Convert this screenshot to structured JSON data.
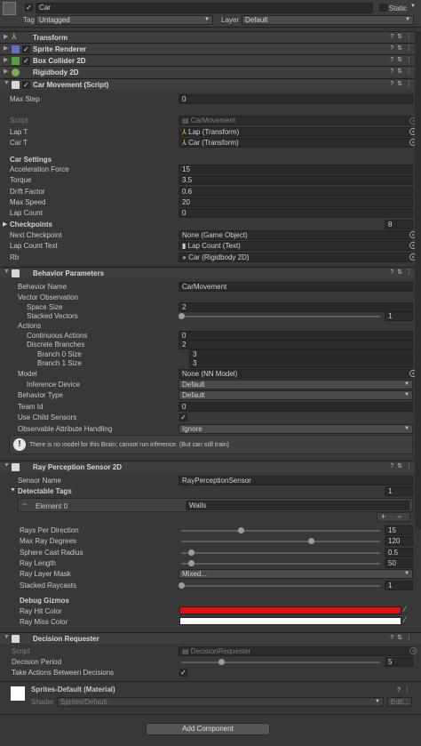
{
  "header": {
    "name": "Car",
    "static_label": "Static",
    "tag_label": "Tag",
    "tag_value": "Untagged",
    "layer_label": "Layer",
    "layer_value": "Default"
  },
  "components": {
    "transform": "Transform",
    "sprite_renderer": "Sprite Renderer",
    "box_collider": "Box Collider 2D",
    "rigidbody": "Rigidbody 2D",
    "car_movement": "Car Movement (Script)",
    "behavior_parameters": "Behavior Parameters",
    "ray_perception": "Ray Perception Sensor 2D",
    "decision_requester": "Decision Requester",
    "material": "Sprites-Default (Material)"
  },
  "car_movement": {
    "max_step_label": "Max Step",
    "max_step": "0",
    "script_label": "Script",
    "script": "CarMovement",
    "lap_t_label": "Lap T",
    "lap_t": "Lap (Transform)",
    "car_t_label": "Car T",
    "car_t": "Car (Transform)",
    "settings_header": "Car Settings",
    "accel_label": "Acceleration Force",
    "accel": "15",
    "torque_label": "Torque",
    "torque": "3.5",
    "drift_label": "Drift Factor",
    "drift": "0.6",
    "max_speed_label": "Max Speed",
    "max_speed": "20",
    "lap_count_label": "Lap Count",
    "lap_count": "0",
    "checkpoints_label": "Checkpoints",
    "checkpoints": "8",
    "next_cp_label": "Next Checkpoint",
    "next_cp": "None (Game Object)",
    "lap_text_label": "Lap Count Text",
    "lap_text": "Lap Count (Text)",
    "rb_label": "Rb",
    "rb": "Car (Rigidbody 2D)"
  },
  "behavior": {
    "name_label": "Behavior Name",
    "name": "CarMovement",
    "vec_obs": "Vector Observation",
    "space_label": "Space Size",
    "space": "2",
    "stacked_label": "Stacked Vectors",
    "stacked": "1",
    "actions": "Actions",
    "cont_label": "Continuous Actions",
    "cont": "0",
    "disc_label": "Discrete Branches",
    "disc": "2",
    "b0_label": "Branch 0 Size",
    "b0": "3",
    "b1_label": "Branch 1 Size",
    "b1": "3",
    "model_label": "Model",
    "model": "None (NN Model)",
    "inf_label": "Inference Device",
    "inf": "Default",
    "type_label": "Behavior Type",
    "type": "Default",
    "team_label": "Team Id",
    "team": "0",
    "child_label": "Use Child Sensors",
    "obs_label": "Observable Attribute Handling",
    "obs": "Ignore",
    "warning": "There is no model for this Brain; cannot run inference. (But can still train)"
  },
  "ray": {
    "sensor_label": "Sensor Name",
    "sensor": "RayPerceptionSensor",
    "tags_label": "Detectable Tags",
    "tags_count": "1",
    "el0_label": "Element 0",
    "el0": "Walls",
    "rays_label": "Rays Per Direction",
    "rays": "15",
    "deg_label": "Max Ray Degrees",
    "deg": "120",
    "sphere_label": "Sphere Cast Radius",
    "sphere": "0.5",
    "len_label": "Ray Length",
    "len": "50",
    "mask_label": "Ray Layer Mask",
    "mask": "Mixed...",
    "stack_label": "Stacked Raycasts",
    "stack": "1",
    "gizmo_header": "Debug Gizmos",
    "hit_label": "Ray Hit Color",
    "miss_label": "Ray Miss Color",
    "hit_color": "#e01010",
    "miss_color": "#ffffff"
  },
  "decision": {
    "script_label": "Script",
    "script": "DecisionRequester",
    "period_label": "Decision Period",
    "period": "5",
    "take_label": "Take Actions Between Decisions"
  },
  "material": {
    "shader_label": "Shader",
    "shader": "Sprites/Default",
    "edit": "Edit..."
  },
  "add_component": "Add Component",
  "sliders": {
    "stacked": 0.0,
    "rays": 0.3,
    "deg": 0.65,
    "sphere": 0.05,
    "len": 0.05,
    "stack": 0.0,
    "period": 0.2
  }
}
